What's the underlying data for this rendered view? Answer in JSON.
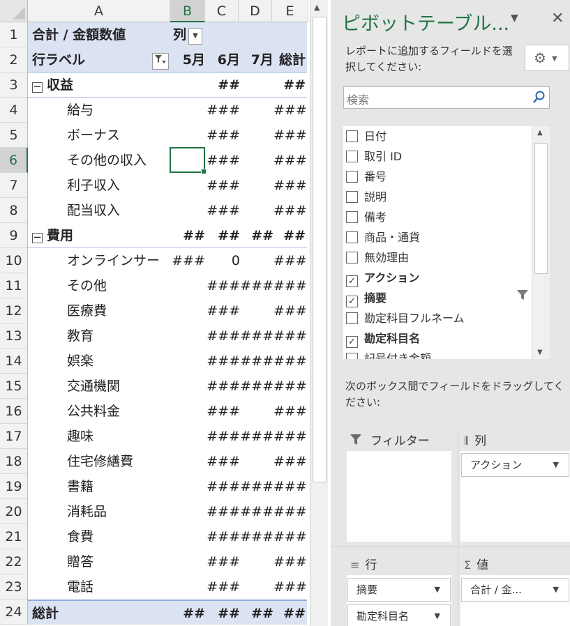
{
  "sheet": {
    "columns": [
      "A",
      "B",
      "C",
      "D",
      "E"
    ],
    "selected_column": "B",
    "selected_row": 6,
    "header_rows": {
      "r1": {
        "a": "合計 / 金額数値",
        "b": "列"
      },
      "r2": {
        "a": "行ラベル",
        "b": "5月",
        "c": "6月",
        "d": "7月",
        "e": "総計"
      }
    },
    "rows": [
      {
        "num": "3",
        "label": "収益",
        "kind": "category",
        "b": "",
        "c": "##",
        "d": "",
        "e": "##"
      },
      {
        "num": "4",
        "label": "給与",
        "kind": "item",
        "b": "",
        "c": "###",
        "d": "",
        "e": "###"
      },
      {
        "num": "5",
        "label": "ボーナス",
        "kind": "item",
        "b": "",
        "c": "###",
        "d": "",
        "e": "###"
      },
      {
        "num": "6",
        "label": "その他の収入",
        "kind": "item",
        "b": "",
        "c": "###",
        "d": "",
        "e": "###"
      },
      {
        "num": "7",
        "label": "利子収入",
        "kind": "item",
        "b": "",
        "c": "###",
        "d": "",
        "e": "###"
      },
      {
        "num": "8",
        "label": "配当収入",
        "kind": "item",
        "b": "",
        "c": "###",
        "d": "",
        "e": "###"
      },
      {
        "num": "9",
        "label": "費用",
        "kind": "category",
        "b": "##",
        "c": "##",
        "d": "##",
        "e": "##"
      },
      {
        "num": "10",
        "label": "オンラインサー",
        "kind": "item",
        "b": "###",
        "c": "0",
        "d": "",
        "e": "###"
      },
      {
        "num": "11",
        "label": "その他",
        "kind": "item",
        "b": "",
        "c": "###",
        "d": "###",
        "e": "###"
      },
      {
        "num": "12",
        "label": "医療費",
        "kind": "item",
        "b": "",
        "c": "###",
        "d": "",
        "e": "###"
      },
      {
        "num": "13",
        "label": "教育",
        "kind": "item",
        "b": "",
        "c": "###",
        "d": "###",
        "e": "###"
      },
      {
        "num": "14",
        "label": "娯楽",
        "kind": "item",
        "b": "",
        "c": "###",
        "d": "###",
        "e": "###"
      },
      {
        "num": "15",
        "label": "交通機関",
        "kind": "item",
        "b": "",
        "c": "###",
        "d": "###",
        "e": "###"
      },
      {
        "num": "16",
        "label": "公共料金",
        "kind": "item",
        "b": "",
        "c": "###",
        "d": "",
        "e": "###"
      },
      {
        "num": "17",
        "label": "趣味",
        "kind": "item",
        "b": "",
        "c": "###",
        "d": "###",
        "e": "###"
      },
      {
        "num": "18",
        "label": "住宅修繕費",
        "kind": "item",
        "b": "",
        "c": "###",
        "d": "",
        "e": "###"
      },
      {
        "num": "19",
        "label": "書籍",
        "kind": "item",
        "b": "",
        "c": "###",
        "d": "###",
        "e": "###"
      },
      {
        "num": "20",
        "label": "消耗品",
        "kind": "item",
        "b": "",
        "c": "###",
        "d": "###",
        "e": "###"
      },
      {
        "num": "21",
        "label": "食費",
        "kind": "item",
        "b": "",
        "c": "###",
        "d": "###",
        "e": "###"
      },
      {
        "num": "22",
        "label": "贈答",
        "kind": "item",
        "b": "",
        "c": "###",
        "d": "",
        "e": "###"
      },
      {
        "num": "23",
        "label": "電話",
        "kind": "item",
        "b": "",
        "c": "###",
        "d": "",
        "e": "###"
      },
      {
        "num": "24",
        "label": "総計",
        "kind": "total",
        "b": "##",
        "c": "##",
        "d": "##",
        "e": "##"
      }
    ]
  },
  "pane": {
    "title": "ピボットテーブル...",
    "choose_text": "レポートに追加するフィールドを選択してください:",
    "search_placeholder": "検索",
    "fields": [
      {
        "label": "日付",
        "checked": false
      },
      {
        "label": "取引 ID",
        "checked": false
      },
      {
        "label": "番号",
        "checked": false
      },
      {
        "label": "説明",
        "checked": false
      },
      {
        "label": "備考",
        "checked": false
      },
      {
        "label": "商品・通貨",
        "checked": false
      },
      {
        "label": "無効理由",
        "checked": false
      },
      {
        "label": "アクション",
        "checked": true
      },
      {
        "label": "摘要",
        "checked": true,
        "filtered": true
      },
      {
        "label": "勘定科目フルネーム",
        "checked": false
      },
      {
        "label": "勘定科目名",
        "checked": true
      },
      {
        "label": "記号付き金額",
        "checked": false
      }
    ],
    "drag_text": "次のボックス間でフィールドをドラッグしてください:",
    "areas": {
      "filter": {
        "label": "フィルター",
        "items": []
      },
      "columns": {
        "label": "列",
        "items": [
          "アクション"
        ]
      },
      "rows": {
        "label": "行",
        "items": [
          "摘要",
          "勘定科目名"
        ]
      },
      "values": {
        "label": "値",
        "items": [
          "合計 / 金..."
        ]
      }
    }
  }
}
